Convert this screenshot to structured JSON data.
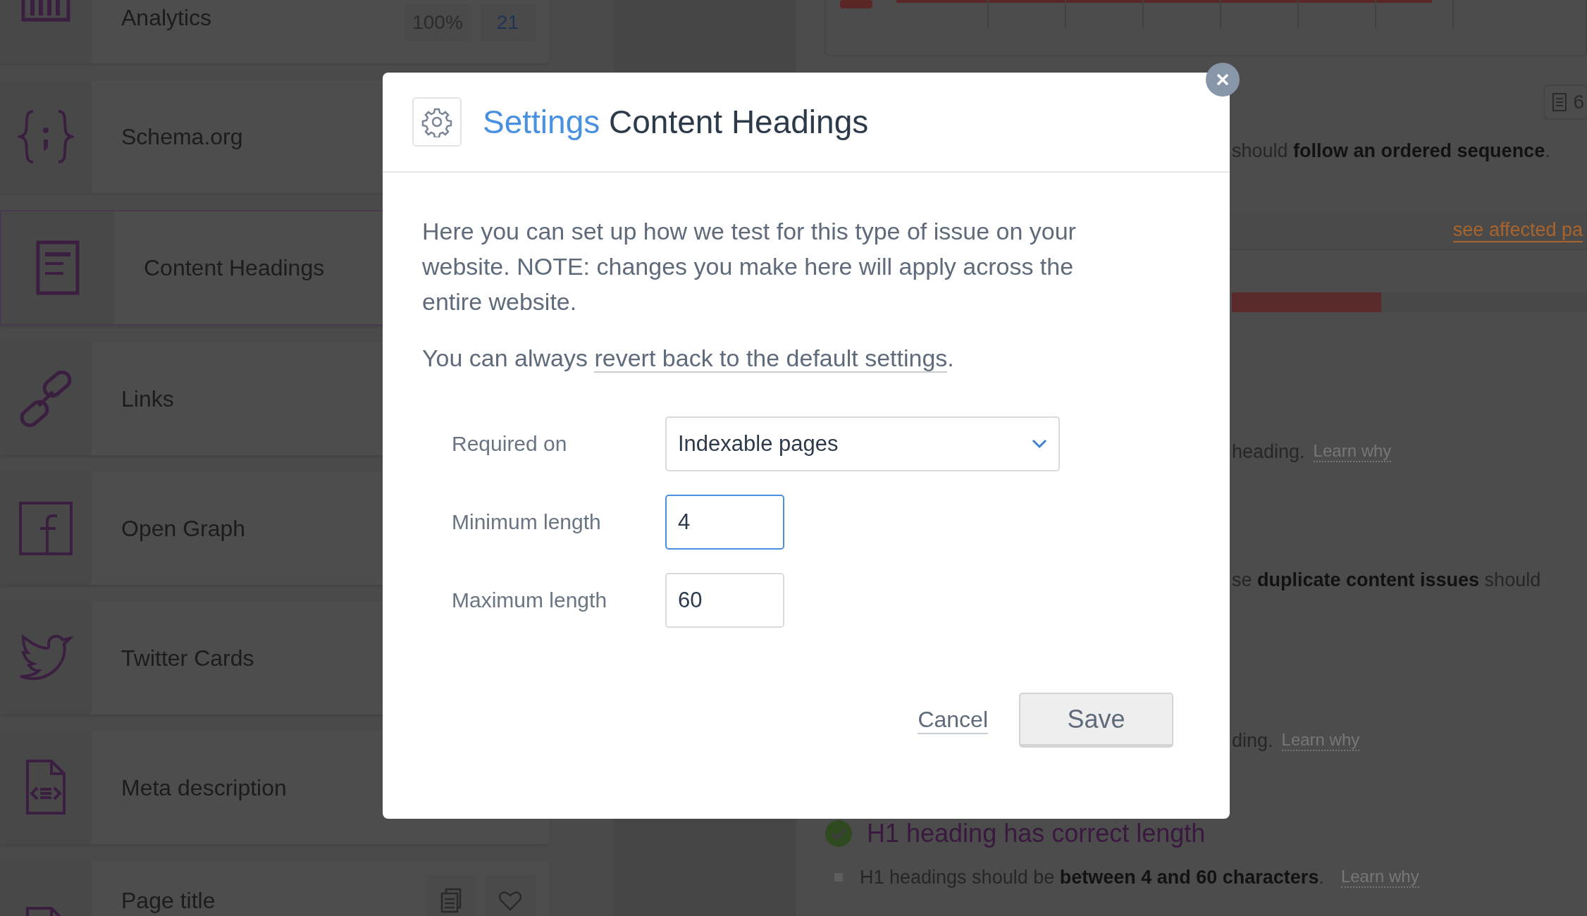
{
  "sidebar": {
    "items": [
      {
        "label": "Analytics",
        "selected": false,
        "badges": [
          "100%",
          "21"
        ]
      },
      {
        "label": "Schema.org",
        "selected": false
      },
      {
        "label": "Content Headings",
        "selected": true
      },
      {
        "label": "Links",
        "selected": false
      },
      {
        "label": "Open Graph",
        "selected": false
      },
      {
        "label": "Twitter Cards",
        "selected": false
      },
      {
        "label": "Meta description",
        "selected": false
      },
      {
        "label": "Page title",
        "selected": false,
        "has_actions": true
      }
    ]
  },
  "main": {
    "count": "6",
    "items": [
      {
        "kind": "sentence",
        "text": "should **follow an ordered sequence**."
      },
      {
        "kind": "band",
        "link": "see affected pa"
      },
      {
        "kind": "bar",
        "level": 0.42
      },
      {
        "kind": "sentence",
        "text": "heading.",
        "link": "Learn why"
      },
      {
        "kind": "sentence",
        "text": "se **duplicate content issues** should"
      },
      {
        "kind": "sentence",
        "text": "ding.",
        "link": "Learn why"
      },
      {
        "kind": "check",
        "text": "H1 heading has correct length",
        "passed": true
      },
      {
        "kind": "bullet",
        "text": "H1 headings should be **between 4 and 60 characters**.",
        "link": "Learn why"
      }
    ]
  },
  "modal": {
    "title_prefix": "Settings",
    "title": "Content Headings",
    "intro": "Here you can set up how we test for this type of issue on your website. NOTE: changes you make here will apply across the entire website.",
    "revert_before": "You can always ",
    "revert_link": "revert back to the default settings",
    "revert_after": ".",
    "fields": [
      {
        "label": "Required on",
        "kind": "select",
        "value": "Indexable pages",
        "focused": false
      },
      {
        "label": "Minimum length",
        "kind": "input",
        "value": "4",
        "focused": true
      },
      {
        "label": "Maximum length",
        "kind": "input",
        "value": "60",
        "focused": false
      }
    ],
    "cancel": "Cancel",
    "save": "Save"
  }
}
